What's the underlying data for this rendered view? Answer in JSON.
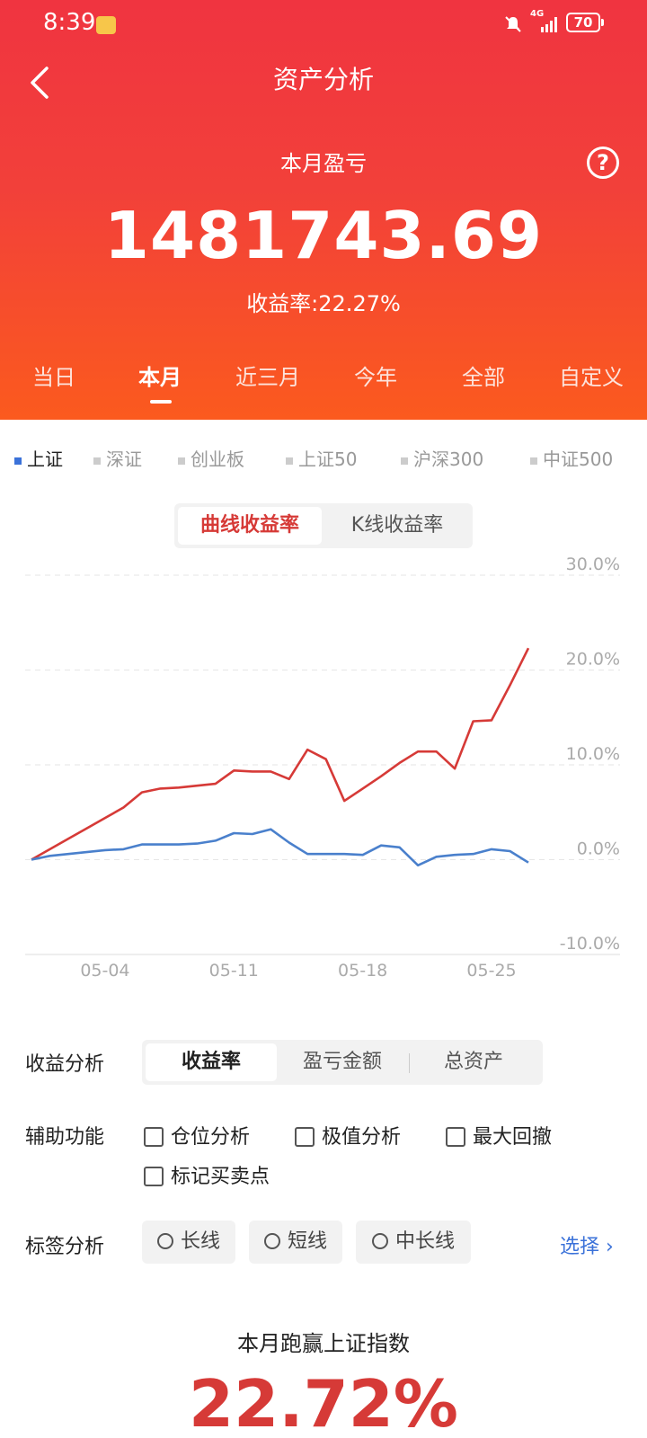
{
  "status_bar": {
    "time": "8:39",
    "network": "4G",
    "battery": "70"
  },
  "header": {
    "title": "资产分析",
    "period_label": "本月盈亏",
    "profit_value": "1481743.69",
    "yield_label": "收益率:22.27%"
  },
  "period_tabs": [
    {
      "label": "当日",
      "active": false
    },
    {
      "label": "本月",
      "active": true
    },
    {
      "label": "近三月",
      "active": false
    },
    {
      "label": "今年",
      "active": false
    },
    {
      "label": "全部",
      "active": false
    },
    {
      "label": "自定义",
      "active": false
    }
  ],
  "benchmarks": [
    {
      "label": "上证",
      "active": true
    },
    {
      "label": "深证",
      "active": false
    },
    {
      "label": "创业板",
      "active": false
    },
    {
      "label": "上证50",
      "active": false
    },
    {
      "label": "沪深300",
      "active": false
    },
    {
      "label": "中证500",
      "active": false
    }
  ],
  "chart_mode": {
    "options": [
      "曲线收益率",
      "K线收益率"
    ],
    "active_index": 0
  },
  "chart_data": {
    "type": "line",
    "y_ticks": [
      "30.0%",
      "20.0%",
      "10.0%",
      "0.0%",
      "-10.0%"
    ],
    "ylim": [
      -10,
      30
    ],
    "x_ticks": [
      "05-04",
      "05-11",
      "05-18",
      "05-25"
    ],
    "x": [
      "04-30",
      "05-01",
      "05-02",
      "05-03",
      "05-04",
      "05-05",
      "05-06",
      "05-07",
      "05-08",
      "05-09",
      "05-10",
      "05-11",
      "05-12",
      "05-13",
      "05-14",
      "05-15",
      "05-16",
      "05-17",
      "05-18",
      "05-19",
      "05-20",
      "05-21",
      "05-22",
      "05-23",
      "05-24",
      "05-25",
      "05-26",
      "05-27"
    ],
    "series": [
      {
        "color": "#d63a37",
        "values": [
          0.0,
          1.1,
          2.2,
          3.3,
          4.4,
          5.5,
          7.1,
          7.5,
          7.6,
          7.8,
          8.0,
          9.4,
          9.3,
          9.3,
          8.5,
          11.6,
          10.6,
          6.2,
          7.5,
          8.8,
          10.2,
          11.4,
          11.4,
          9.6,
          14.6,
          14.7,
          18.4,
          22.3
        ],
        "note_unused": ""
      },
      {
        "color": "#4a80cc",
        "values": [
          0.0,
          0.4,
          0.6,
          0.8,
          1.0,
          1.1,
          1.6,
          1.6,
          1.6,
          1.7,
          2.0,
          2.8,
          2.7,
          3.2,
          1.8,
          0.6,
          0.6,
          0.6,
          0.5,
          1.5,
          1.3,
          -0.6,
          0.3,
          0.5,
          0.6,
          1.1,
          0.9,
          -0.3
        ]
      }
    ]
  },
  "income_analysis": {
    "label": "收益分析",
    "options": [
      "收益率",
      "盈亏金额",
      "总资产"
    ],
    "active_index": 0
  },
  "aux_functions": {
    "label": "辅助功能",
    "options": [
      "仓位分析",
      "极值分析",
      "最大回撤",
      "标记买卖点"
    ]
  },
  "tag_analysis": {
    "label": "标签分析",
    "options": [
      "长线",
      "短线",
      "中长线"
    ],
    "select_label": "选择"
  },
  "beat_index": {
    "label": "本月跑赢上证指数",
    "value": "22.72%"
  },
  "colors": {
    "brand_red": "#f03440",
    "accent_blue": "#3b72d9"
  }
}
